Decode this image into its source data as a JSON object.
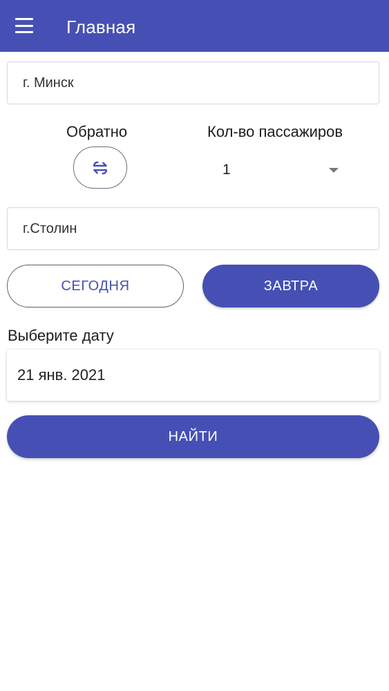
{
  "appbar": {
    "title": "Главная",
    "menu_icon": "hamburger-menu-icon",
    "color": "#4650b4"
  },
  "route": {
    "from_value": "г. Минск",
    "to_value": "г.Столин",
    "back_label": "Обратно",
    "swap_icon": "swap-arrows-icon"
  },
  "passengers": {
    "label": "Кол-во пассажиров",
    "value": "1"
  },
  "quick_dates": {
    "today_label": "СЕГОДНЯ",
    "tomorrow_label": "ЗАВТРА",
    "selected": "tomorrow"
  },
  "date": {
    "label": "Выберите дату",
    "value": "21 янв. 2021"
  },
  "search": {
    "label": "НАЙТИ"
  }
}
